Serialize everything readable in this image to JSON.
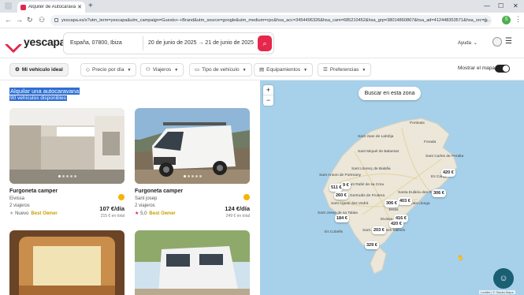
{
  "browser": {
    "tab_title": "Alquiler de Autocaravanas en Ibiza",
    "url": "yescapa.es/s?utm_term=yescapa&utm_campaign=Guests+-+Brand&utm_source=google&utm_medium=cpc&hsa_acc=3454496326&hsa_cam=685210452&hsa_grp=38014860867&hsa_ad=412448353571&hsa_src=g...",
    "profile_initial": "S"
  },
  "header": {
    "logo": "yescapa",
    "location": "España, 07800, Ibiza",
    "date_from": "20 de junio de 2025",
    "date_to": "21 de junio de 2025",
    "help_label": "Ayuda"
  },
  "filters": {
    "items": [
      "Mi vehículo ideal",
      "Precio por día",
      "Viajeros",
      "Tipo de vehículo",
      "Equipamientos",
      "Preferencias"
    ],
    "map_toggle_label": "Mostrar el mapa"
  },
  "results": {
    "title": "Alquilar una autocaravana",
    "count": "90 vehículos disponibles",
    "cards": [
      {
        "title": "Furgoneta camper",
        "location": "Eivissa",
        "travelers": "2 viajeros",
        "price": "107 €/día",
        "total": "215 € en total",
        "rating": "Nuevo",
        "owner": "Best Owner"
      },
      {
        "title": "Furgoneta camper",
        "location": "Sant josep",
        "travelers": "2 viajeros",
        "price": "124 €/día",
        "total": "249 € en total",
        "rating": "5,0",
        "owner": "Best Owner"
      }
    ]
  },
  "map": {
    "search_zone_label": "Buscar en esta zona",
    "zoom_in": "+",
    "zoom_out": "−",
    "attribution": "Leaflet | © Stadia Maps",
    "towns": [
      "Portinatx",
      "Sant Joan de Labritja",
      "Sant Miquel de Balansat",
      "Sant Llorenç de Balafia",
      "Sant Antoni de Portmany",
      "Santa Gertrudis de Fruitera",
      "Santa Eulària des Riu",
      "Sant Carles de Peralta",
      "Sant Josep de sa Talaia",
      "Sant Jordi de ses Salines",
      "Eivissa",
      "Sant Rafel de sa Creu",
      "Forada",
      "Cala Llonga",
      "Es Canar",
      "Jesús",
      "Sant Agustí des Vedrà",
      "Es Cubells"
    ],
    "pins": [
      "420 €",
      "511 €",
      "9 €",
      "260 €",
      "306 €",
      "403 €",
      "306 €",
      "416 €",
      "184 €",
      "420 €",
      "203 €",
      "329 €"
    ]
  }
}
